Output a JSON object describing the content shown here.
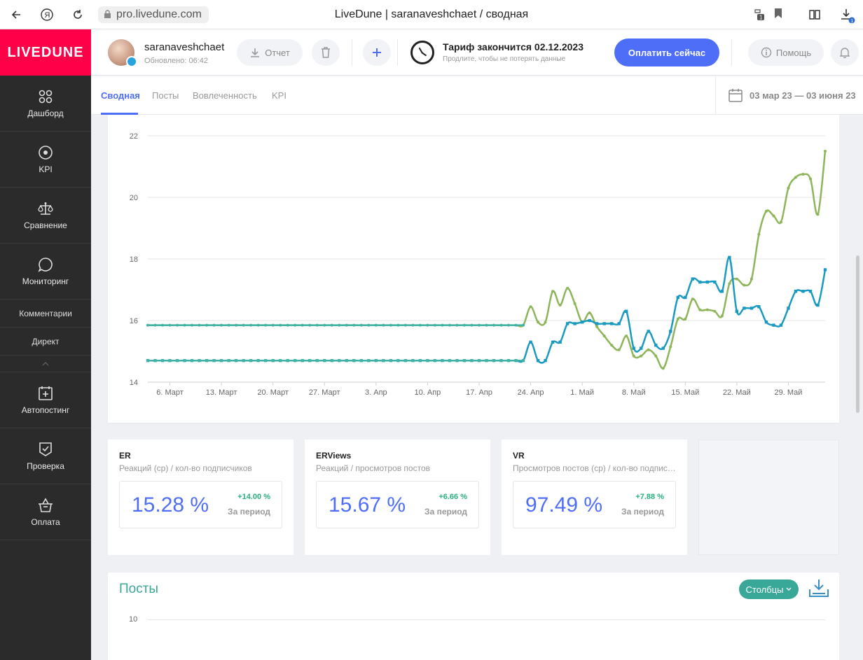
{
  "browser": {
    "url": "pro.livedune.com",
    "title": "LiveDune | saranaveshchaet / сводная",
    "badge_count": "1"
  },
  "sidebar": {
    "logo": "LIVEDUNE",
    "items": [
      {
        "label": "Дашборд",
        "icon": "grid-circles-icon"
      },
      {
        "label": "KPI",
        "icon": "target-icon"
      },
      {
        "label": "Сравнение",
        "icon": "scales-icon"
      },
      {
        "label": "Мониторинг",
        "icon": "chat-bubble-icon"
      }
    ],
    "subitems": [
      "Комментарии",
      "Директ"
    ],
    "items2": [
      {
        "label": "Автопостинг",
        "icon": "calendar-plus-icon"
      },
      {
        "label": "Проверка",
        "icon": "shield-check-icon"
      },
      {
        "label": "Оплата",
        "icon": "basket-icon"
      }
    ]
  },
  "header": {
    "account_name": "saranaveshchaet",
    "updated": "Обновлено: 06:42",
    "report_label": "Отчет",
    "tariff_title": "Тариф закончится 02.12.2023",
    "tariff_sub": "Продлите, чтобы не потерять данные",
    "pay_label": "Оплатить сейчас",
    "help_label": "Помощь"
  },
  "tabs": [
    "Сводная",
    "Посты",
    "Вовлеченность",
    "KPI"
  ],
  "date_range": "03 мар 23 — 03 июня 23",
  "chart_data": {
    "type": "line",
    "ylim": [
      14,
      22
    ],
    "y_ticks": [
      14,
      16,
      18,
      20,
      22
    ],
    "x_ticks": [
      "6. Март",
      "13. Март",
      "20. Март",
      "27. Март",
      "3. Апр",
      "10. Апр",
      "17. Апр",
      "24. Апр",
      "1. Май",
      "8. Май",
      "15. Май",
      "22. Май",
      "29. Май"
    ],
    "x_start_day_offset": 3,
    "series": [
      {
        "color": "#8db55a",
        "values": [
          15.85,
          15.85,
          15.85,
          15.85,
          15.85,
          15.85,
          15.85,
          15.85,
          15.85,
          15.85,
          15.85,
          15.85,
          15.85,
          15.85,
          15.85,
          15.85,
          15.85,
          15.85,
          15.85,
          15.85,
          15.85,
          15.85,
          15.85,
          15.85,
          15.85,
          15.85,
          15.85,
          15.85,
          15.85,
          15.85,
          15.85,
          15.85,
          15.85,
          15.85,
          15.85,
          15.85,
          15.85,
          15.85,
          15.85,
          15.85,
          15.85,
          15.85,
          15.85,
          15.85,
          15.85,
          15.85,
          15.85,
          15.85,
          15.85,
          15.85,
          15.85,
          15.85,
          16.45,
          15.95,
          15.95,
          16.95,
          16.5,
          17.05,
          16.55,
          15.95,
          16.25,
          15.8,
          15.5,
          15.2,
          15.05,
          15.5,
          14.85,
          14.85,
          15.05,
          14.85,
          14.45,
          15.15,
          16.05,
          16.05,
          16.7,
          16.35,
          16.35,
          16.3,
          16.15,
          17.2,
          17.35,
          17.15,
          17.35,
          18.8,
          19.55,
          19.4,
          19.2,
          20.3,
          20.65,
          20.75,
          20.6,
          19.45,
          21.5
        ]
      },
      {
        "color": "#1a9ac0",
        "values": [
          14.7,
          14.7,
          14.7,
          14.7,
          14.7,
          14.7,
          14.7,
          14.7,
          14.7,
          14.7,
          14.7,
          14.7,
          14.7,
          14.7,
          14.7,
          14.7,
          14.7,
          14.7,
          14.7,
          14.7,
          14.7,
          14.7,
          14.7,
          14.7,
          14.7,
          14.7,
          14.7,
          14.7,
          14.7,
          14.7,
          14.7,
          14.7,
          14.7,
          14.7,
          14.7,
          14.7,
          14.7,
          14.7,
          14.7,
          14.7,
          14.7,
          14.7,
          14.7,
          14.7,
          14.7,
          14.7,
          14.7,
          14.7,
          14.7,
          14.7,
          14.7,
          14.7,
          15.3,
          14.7,
          14.7,
          15.3,
          15.3,
          15.9,
          15.9,
          15.95,
          16.0,
          15.9,
          15.9,
          15.9,
          15.9,
          16.3,
          15.1,
          15.1,
          15.65,
          15.2,
          15.1,
          15.65,
          16.75,
          16.75,
          17.35,
          17.25,
          17.25,
          17.25,
          16.95,
          18.05,
          16.3,
          16.4,
          16.4,
          16.45,
          15.95,
          15.85,
          15.85,
          16.4,
          16.95,
          16.95,
          16.95,
          16.5,
          17.65
        ]
      }
    ]
  },
  "metrics": [
    {
      "title": "ER",
      "subtitle": "Реакций (ср) / кол-во подписчиков",
      "value": "15.28 %",
      "delta": "+14.00 %",
      "period": "За период"
    },
    {
      "title": "ERViews",
      "subtitle": "Реакций / просмотров постов",
      "value": "15.67 %",
      "delta": "+6.66 %",
      "period": "За период"
    },
    {
      "title": "VR",
      "subtitle": "Просмотров постов (ср) / кол-во подписчиков",
      "value": "97.49 %",
      "delta": "+7.88 %",
      "period": "За период"
    }
  ],
  "posts": {
    "title": "Посты",
    "columns_label": "Столбцы",
    "y_tick": "10"
  }
}
